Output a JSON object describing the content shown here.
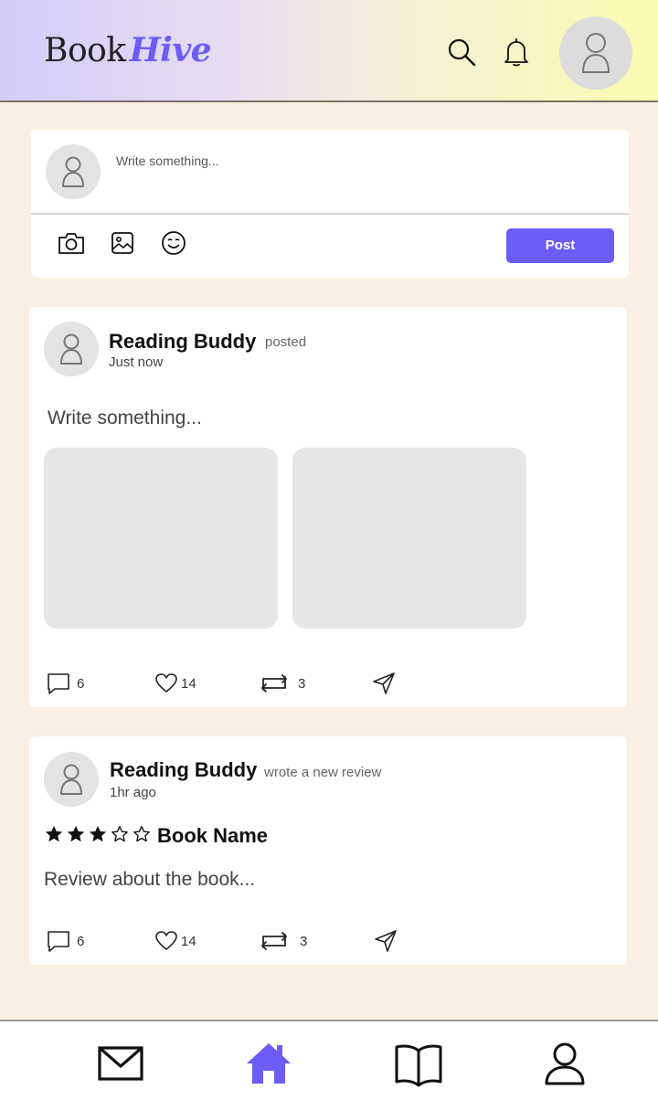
{
  "app": {
    "logo_part1": "Book",
    "logo_part2": "Hive",
    "accent_color": "#6e5cf6"
  },
  "header": {
    "icons": [
      "search-icon",
      "bell-icon",
      "profile-avatar"
    ]
  },
  "composer": {
    "placeholder": "Write something...",
    "tools": [
      "camera-icon",
      "image-icon",
      "emoji-icon"
    ],
    "post_label": "Post"
  },
  "feed": {
    "post1": {
      "author": "Reading Buddy",
      "action": "posted",
      "time": "Just now",
      "text": "Write something...",
      "comments": "6",
      "likes": "14",
      "reposts": "3"
    },
    "post2": {
      "author": "Reading Buddy",
      "action": "wrote a new review",
      "time": "1hr ago",
      "rating": 3,
      "rating_max": 5,
      "book_name": "Book Name",
      "text": "Review about the book...",
      "comments": "6",
      "likes": "14",
      "reposts": "3"
    }
  },
  "bottom_nav": {
    "items": [
      "messages",
      "home",
      "library",
      "profile"
    ],
    "active": "home"
  }
}
